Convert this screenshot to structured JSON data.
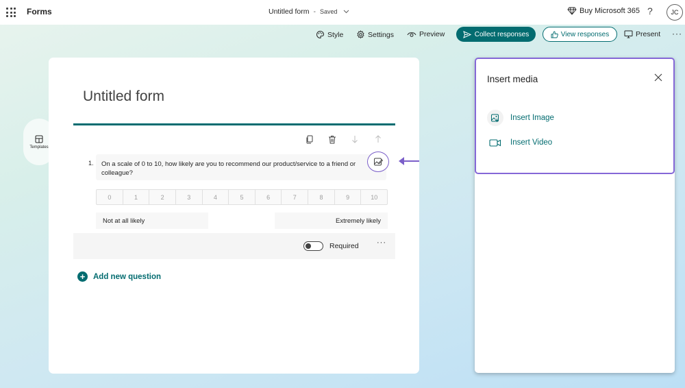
{
  "header": {
    "app_name": "Forms",
    "doc_title": "Untitled form",
    "separator": "-",
    "save_status": "Saved",
    "buy_label": "Buy Microsoft 365",
    "help_label": "?",
    "avatar_initials": "JC"
  },
  "toolbar": {
    "style_label": "Style",
    "settings_label": "Settings",
    "preview_label": "Preview",
    "collect_label": "Collect responses",
    "view_label": "View responses",
    "present_label": "Present",
    "more_label": "···"
  },
  "sidebar": {
    "templates_label": "Templates"
  },
  "form": {
    "title": "Untitled form",
    "question": {
      "number": "1.",
      "text": "On a scale of 0 to 10, how likely are you to recommend our product/service to a friend or colleague?",
      "scale": [
        "0",
        "1",
        "2",
        "3",
        "4",
        "5",
        "6",
        "7",
        "8",
        "9",
        "10"
      ],
      "low_label": "Not at all likely",
      "high_label": "Extremely likely",
      "required_label": "Required",
      "required_on": false,
      "more_label": "···"
    },
    "add_question_label": "Add new question"
  },
  "panel": {
    "title": "Insert media",
    "items": [
      {
        "label": "Insert Image",
        "icon": "image-icon"
      },
      {
        "label": "Insert Video",
        "icon": "video-icon"
      }
    ]
  },
  "colors": {
    "accent": "#036c70",
    "highlight": "#8467d7"
  }
}
